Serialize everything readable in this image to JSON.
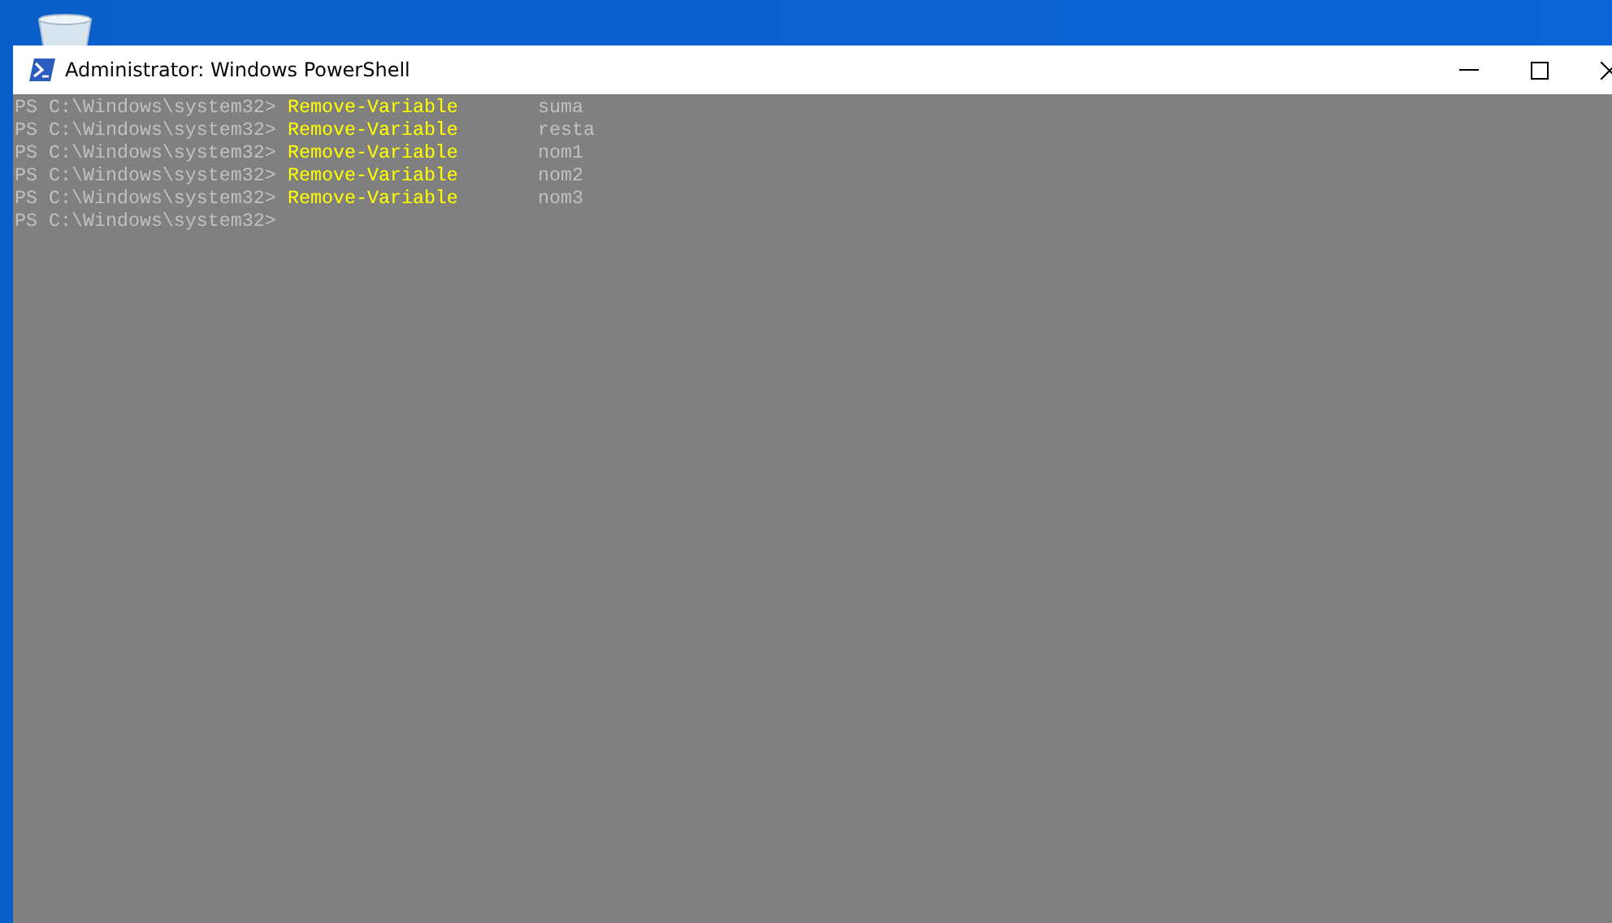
{
  "window": {
    "title": "Administrator: Windows PowerShell"
  },
  "console": {
    "lines": [
      {
        "prompt": "PS C:\\Windows\\system32>",
        "command": "Remove-Variable",
        "argument": "suma"
      },
      {
        "prompt": "PS C:\\Windows\\system32>",
        "command": "Remove-Variable",
        "argument": "resta"
      },
      {
        "prompt": "PS C:\\Windows\\system32>",
        "command": "Remove-Variable",
        "argument": "nom1"
      },
      {
        "prompt": "PS C:\\Windows\\system32>",
        "command": "Remove-Variable",
        "argument": "nom2"
      },
      {
        "prompt": "PS C:\\Windows\\system32>",
        "command": "Remove-Variable",
        "argument": "nom3"
      },
      {
        "prompt": "PS C:\\Windows\\system32>"
      }
    ]
  }
}
